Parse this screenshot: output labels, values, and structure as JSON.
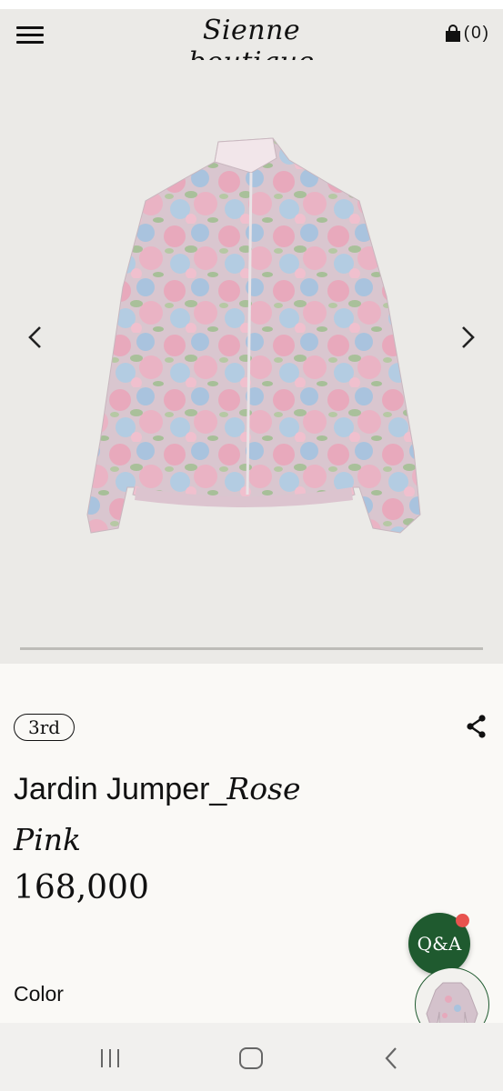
{
  "header": {
    "logo_text": "Sienne boutique",
    "cart_count": "(0)",
    "icons": [
      "hamburger-menu-icon",
      "shopping-bag-icon"
    ]
  },
  "gallery": {
    "image_description_icon": "floral-jacket-image",
    "prev_icon": "chevron-left-icon",
    "next_icon": "chevron-right-icon"
  },
  "product": {
    "badge": "3rd",
    "title_sans": "Jardin Jumper_",
    "title_serif_1": "Rose",
    "title_serif_2": "Pink",
    "price": "168,000",
    "color_label": "Color"
  },
  "floating": {
    "qa_label": "Q&A"
  },
  "system_nav": {
    "icons": [
      "recents-icon",
      "home-icon",
      "back-icon"
    ]
  },
  "colors": {
    "header_bg": "#ebeae7",
    "page_bg": "#faf9f6",
    "qa_green": "#1f5a2f",
    "notification_red": "#e8534f"
  }
}
